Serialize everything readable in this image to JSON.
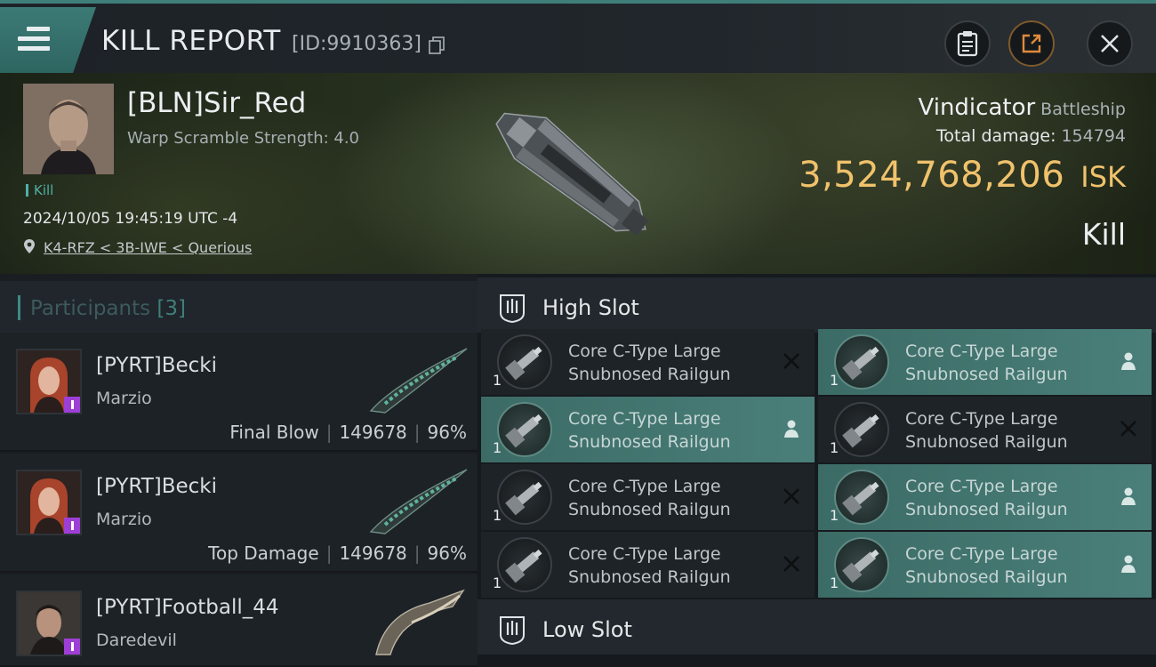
{
  "header": {
    "title": "KILL REPORT",
    "kill_id": "[ID:9910363]"
  },
  "victim": {
    "name": "[BLN]Sir_Red",
    "warp_scramble": "Warp Scramble Strength: 4.0",
    "tag": "Kill",
    "datetime": "2024/10/05 19:45:19 UTC -4",
    "location": "K4-RFZ < 3B-IWE < Querious",
    "ship": "Vindicator",
    "ship_class": "Battleship",
    "total_damage_label": "Total damage:",
    "total_damage": "154794",
    "isk_value": "3,524,768,206",
    "isk_unit": "ISK",
    "result": "Kill"
  },
  "participants": {
    "label": "Participants",
    "count": "[3]",
    "rows": [
      {
        "name": "[PYRT]Becki",
        "ship": "Marzio",
        "role": "Final Blow",
        "damage": "149678",
        "percent": "96%"
      },
      {
        "name": "[PYRT]Becki",
        "ship": "Marzio",
        "role": "Top Damage",
        "damage": "149678",
        "percent": "96%"
      },
      {
        "name": "[PYRT]Football_44",
        "ship": "Daredevil",
        "role": "",
        "damage": "",
        "percent": ""
      }
    ]
  },
  "fitting": {
    "high_slot_label": "High Slot",
    "low_slot_label": "Low Slot",
    "high_modules": [
      {
        "line1": "Core C-Type Large",
        "line2": "Snubnosed Railgun",
        "qty": "1",
        "state": "destroyed"
      },
      {
        "line1": "Core C-Type Large",
        "line2": "Snubnosed Railgun",
        "qty": "1",
        "state": "dropped"
      },
      {
        "line1": "Core C-Type Large",
        "line2": "Snubnosed Railgun",
        "qty": "1",
        "state": "dropped"
      },
      {
        "line1": "Core C-Type Large",
        "line2": "Snubnosed Railgun",
        "qty": "1",
        "state": "destroyed"
      },
      {
        "line1": "Core C-Type Large",
        "line2": "Snubnosed Railgun",
        "qty": "1",
        "state": "destroyed"
      },
      {
        "line1": "Core C-Type Large",
        "line2": "Snubnosed Railgun",
        "qty": "1",
        "state": "dropped"
      },
      {
        "line1": "Core C-Type Large",
        "line2": "Snubnosed Railgun",
        "qty": "1",
        "state": "destroyed"
      },
      {
        "line1": "Core C-Type Large",
        "line2": "Snubnosed Railgun",
        "qty": "1",
        "state": "dropped"
      }
    ]
  },
  "colors": {
    "accent_teal": "#3f7f7a",
    "isk_gold": "#f0c26c",
    "dropped_bg": "#4a7f79",
    "purple_badge": "#9d3fd6"
  }
}
